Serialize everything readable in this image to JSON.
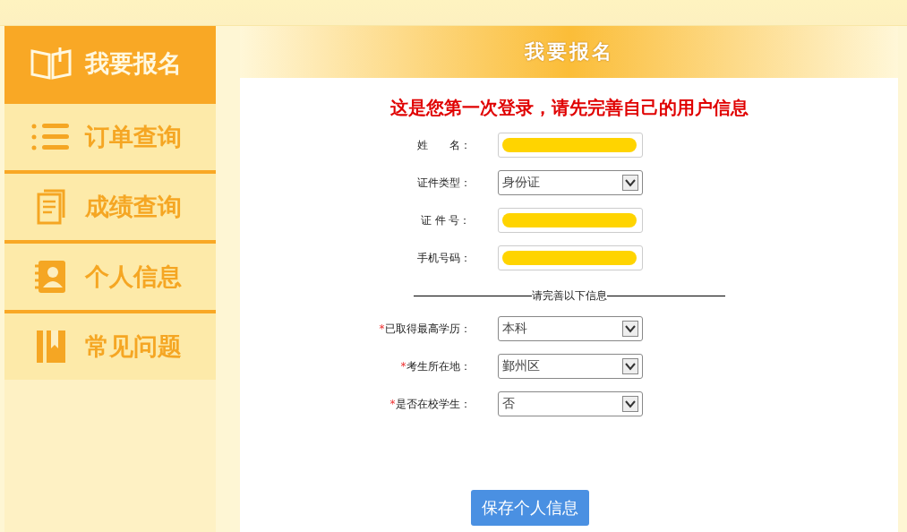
{
  "sidebar": {
    "items": [
      {
        "label": "我要报名",
        "selected": true
      },
      {
        "label": "订单查询",
        "selected": false
      },
      {
        "label": "成绩查询",
        "selected": false
      },
      {
        "label": "个人信息",
        "selected": false
      },
      {
        "label": "常见问题",
        "selected": false
      }
    ]
  },
  "panel": {
    "title": "我要报名",
    "notice": "这是您第一次登录，请先完善自己的用户信息",
    "fields": [
      {
        "label": "姓　　名：",
        "kind": "text",
        "redacted": true
      },
      {
        "label": "证件类型：",
        "kind": "select",
        "value": "身份证"
      },
      {
        "label": "证 件 号：",
        "kind": "text",
        "redacted": true
      },
      {
        "label": "手机号码：",
        "kind": "text",
        "redacted": true
      }
    ],
    "section_label": "请完善以下信息",
    "extra_fields": [
      {
        "label": "已取得最高学历：",
        "kind": "select",
        "value": "本科",
        "required_mark": "*"
      },
      {
        "label": "考生所在地：",
        "kind": "select",
        "value": "鄞州区",
        "required_mark": "*"
      },
      {
        "label": "是否在校学生：",
        "kind": "select",
        "value": "否",
        "required_mark": "*"
      }
    ],
    "save_button": "保存个人信息"
  }
}
